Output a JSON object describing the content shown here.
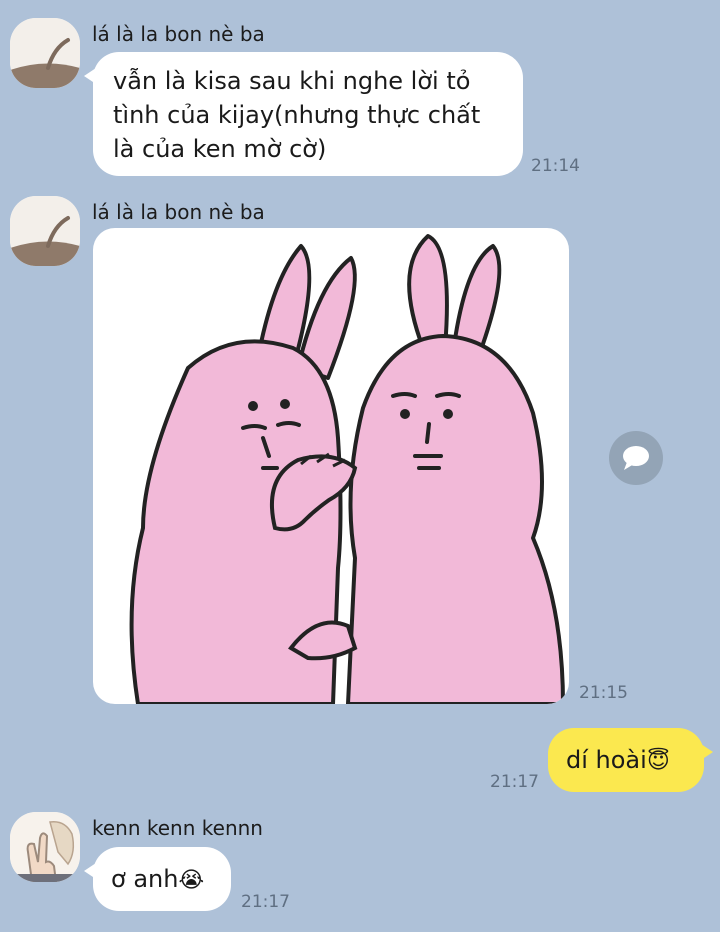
{
  "messages": [
    {
      "sender": "lá là la bon nè ba",
      "lines": [
        "vẫn là kisa sau khi nghe lời tỏ",
        "tình của kijay(nhưng thực chất",
        "là của ken mờ cờ)"
      ],
      "time": "21:14"
    },
    {
      "sender": "lá là la bon nè ba",
      "sticker": "two-pink-rabbits-whispering",
      "time": "21:15"
    },
    {
      "text": "dí hoài",
      "emoji": "😇",
      "time": "21:17",
      "outgoing": true
    },
    {
      "sender": "kenn kenn kennn",
      "text": "ơ anh",
      "emoji": "😭",
      "time": "21:17"
    }
  ],
  "colors": {
    "background": "#aec1d8",
    "incoming_bubble": "#ffffff",
    "outgoing_bubble": "#fbe84f",
    "rabbit_pink": "#f2b9d8"
  },
  "icons": {
    "share": "speech-bubble-icon"
  }
}
